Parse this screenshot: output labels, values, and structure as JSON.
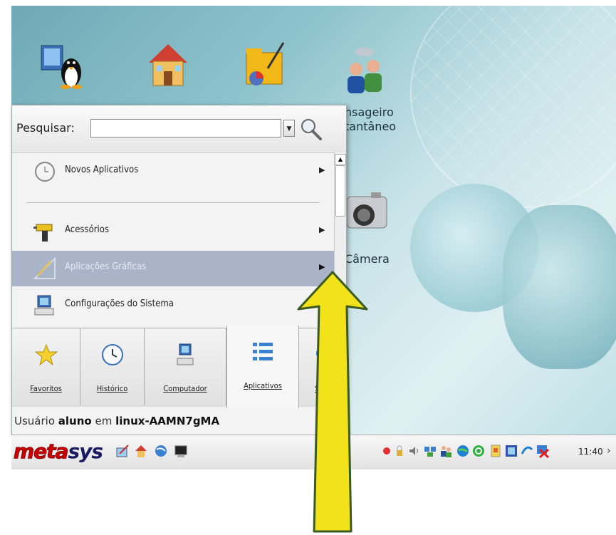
{
  "desktop": {
    "icons": [
      {
        "name": "mensageiro",
        "label": "nsageiro\ntantâneo"
      },
      {
        "name": "camera",
        "label": "Câmera"
      }
    ]
  },
  "menu": {
    "search": {
      "label": "Pesquisar:",
      "value": "",
      "placeholder": ""
    },
    "items": [
      {
        "label": "Novos Aplicativos",
        "icon": "clock-icon"
      },
      {
        "label": "Acessórios",
        "icon": "drill-icon"
      },
      {
        "label": "Aplicações Gráficas",
        "icon": "graphics-icon",
        "highlighted": true
      },
      {
        "label": "Configurações do Sistema",
        "icon": "computer-settings-icon"
      }
    ],
    "tabs": [
      {
        "label": "Favoritos",
        "icon": "star-icon"
      },
      {
        "label": "Histórico",
        "icon": "clock-icon"
      },
      {
        "label": "Computador",
        "icon": "computer-icon"
      },
      {
        "label": "Aplicativos",
        "icon": "apps-list-icon",
        "active": true
      },
      {
        "label": "S",
        "icon": "partial-icon"
      }
    ],
    "user": {
      "prefix": "Usuário",
      "name": "aluno",
      "mid": "em",
      "host": "linux-AAMN7gMA"
    }
  },
  "taskbar": {
    "logo_meta": "meta",
    "logo_sys": "sys",
    "clock": "11:40",
    "chevron": "›"
  },
  "arrow_color": "#f2e21a"
}
